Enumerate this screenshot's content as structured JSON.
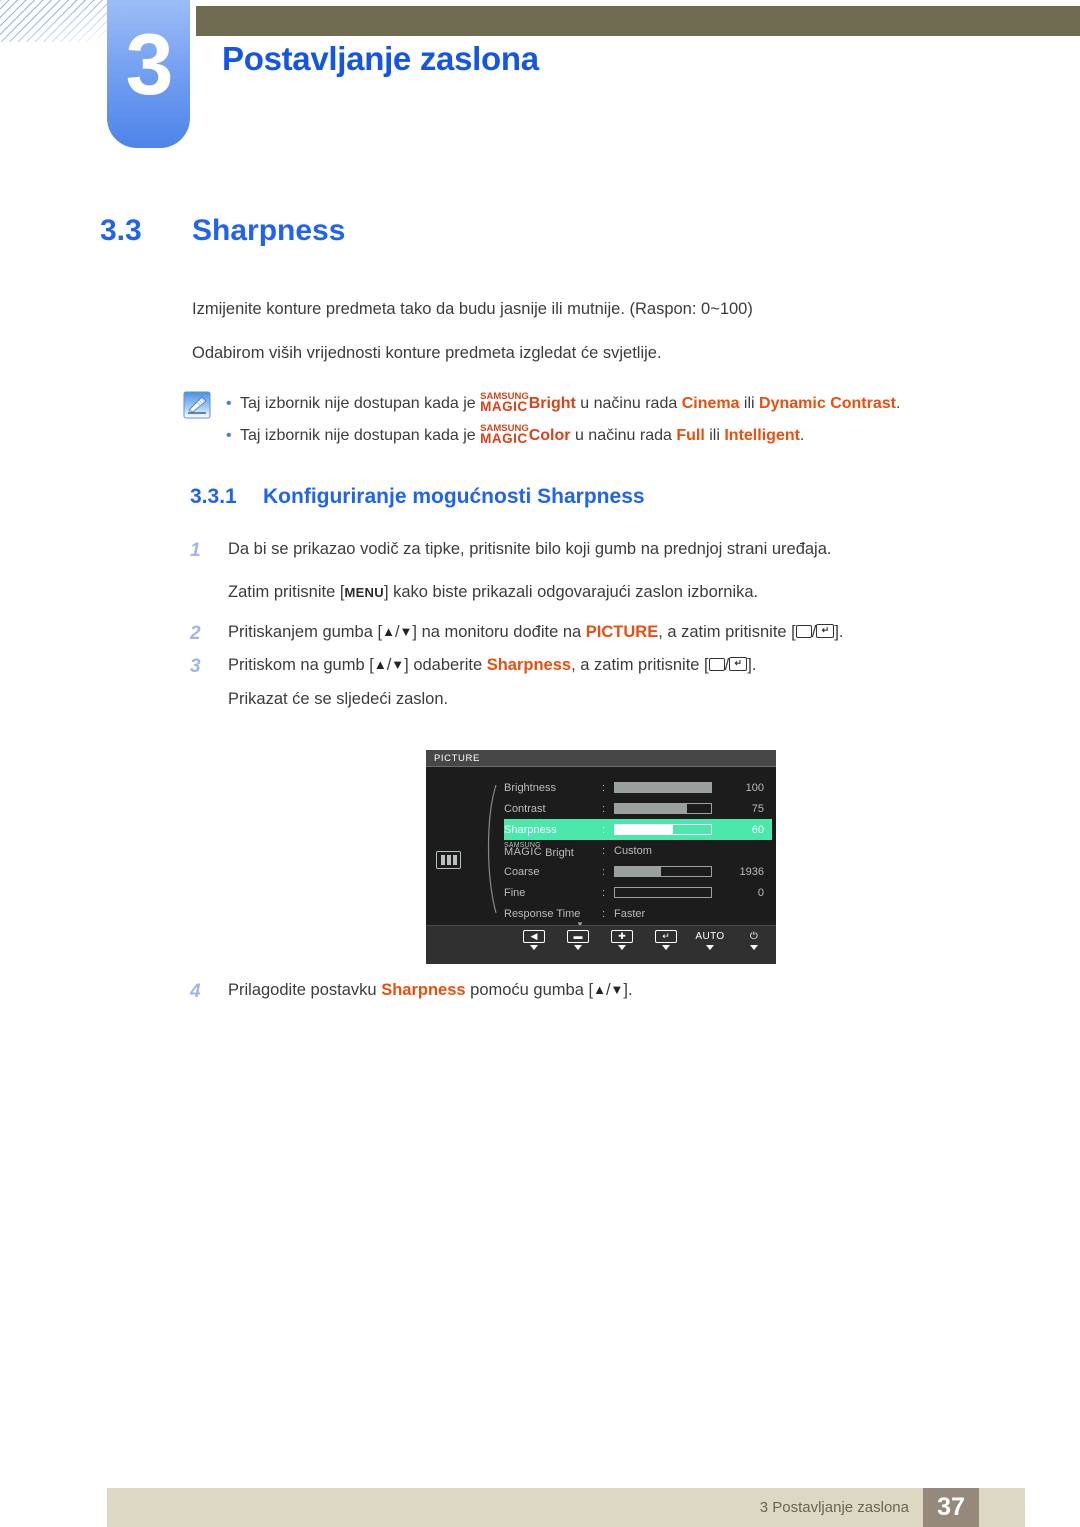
{
  "header": {
    "chapter_number": "3",
    "chapter_title": "Postavljanje zaslona"
  },
  "section": {
    "number": "3.3",
    "title": "Sharpness"
  },
  "intro": {
    "line1": "Izmijenite konture predmeta tako da budu jasnije ili mutnije. (Raspon: 0~100)",
    "line2": "Odabirom viših vrijednosti konture predmeta izgledat će svjetlije."
  },
  "note": {
    "icon": "note-pencil-icon",
    "bullets": [
      {
        "pre": "Taj izbornik nije dostupan kada je ",
        "magic_top": "SAMSUNG",
        "magic_bottom": "MAGIC",
        "magic_suffix": "Bright",
        "mid": " u načinu rada ",
        "kw1": "Cinema",
        "conj": " ili ",
        "kw2": "Dynamic Contrast",
        "post": "."
      },
      {
        "pre": "Taj izbornik nije dostupan kada je ",
        "magic_top": "SAMSUNG",
        "magic_bottom": "MAGIC",
        "magic_suffix": "Color",
        "mid": " u načinu rada ",
        "kw1": "Full",
        "conj": " ili ",
        "kw2": "Intelligent",
        "post": "."
      }
    ]
  },
  "subsection": {
    "number": "3.3.1",
    "title": "Konfiguriranje mogućnosti Sharpness"
  },
  "steps": {
    "step1": {
      "num": "1",
      "text": "Da bi se prikazao vodič za tipke, pritisnite bilo koji gumb na prednjoj strani uređaja.",
      "sub_pre": "Zatim pritisnite [",
      "sub_key": "MENU",
      "sub_post": "] kako biste prikazali odgovarajući zaslon izbornika."
    },
    "step2": {
      "num": "2",
      "t1": "Pritiskanjem gumba [",
      "t2": "] na monitoru dođite na ",
      "kw": "PICTURE",
      "t3": ", a zatim pritisnite [",
      "t4": "]."
    },
    "step3": {
      "num": "3",
      "t1": "Pritiskom na gumb [",
      "t2": "] odaberite ",
      "kw": "Sharpness",
      "t3": ", a zatim pritisnite [",
      "t4": "].",
      "sub": "Prikazat će se sljedeći zaslon."
    },
    "step4": {
      "num": "4",
      "t1": "Prilagodite postavku ",
      "kw": "Sharpness",
      "t2": " pomoću gumba [",
      "t3": "]."
    }
  },
  "osd": {
    "title": "PICTURE",
    "left_icon": "picture-bars-icon",
    "rows": [
      {
        "label": "Brightness",
        "type": "bar",
        "percent": 100,
        "value": "100"
      },
      {
        "label": "Contrast",
        "type": "bar",
        "percent": 75,
        "value": "75"
      },
      {
        "label": "Sharpness",
        "type": "bar",
        "percent": 60,
        "value": "60",
        "selected": true
      },
      {
        "label": "MAGIC Bright",
        "type": "text",
        "value": "Custom",
        "magic_top": "SAMSUNG",
        "magic_bottom": "MAGIC",
        "magic_suffix": " Bright"
      },
      {
        "label": "Coarse",
        "type": "bar",
        "percent": 48,
        "value": "1936"
      },
      {
        "label": "Fine",
        "type": "bar",
        "percent": 0,
        "value": "0"
      },
      {
        "label": "Response Time",
        "type": "text",
        "value": "Faster"
      }
    ],
    "scroll_down": "▼",
    "toolbar": [
      {
        "name": "back-button",
        "glyph": "◀",
        "bare": false
      },
      {
        "name": "minus-button",
        "glyph": "▬",
        "bare": false
      },
      {
        "name": "plus-button",
        "glyph": "✚",
        "bare": false
      },
      {
        "name": "enter-button",
        "glyph": "↵",
        "bare": false
      },
      {
        "name": "auto-button",
        "glyph": "AUTO",
        "bare": true
      },
      {
        "name": "power-button",
        "glyph": "⏻",
        "bare": true
      }
    ]
  },
  "footer": {
    "text": "3 Postavljanje zaslona",
    "page": "37"
  },
  "colors": {
    "heading_blue": "#1f63ee",
    "keyword_orange": "#e8500f",
    "magic_red": "#d9421a",
    "osd_highlight_green": "#4ae8ab",
    "footer_bar": "#ddd8c4",
    "footer_page_box": "#96897c",
    "olive_bar": "#6f6b51"
  }
}
